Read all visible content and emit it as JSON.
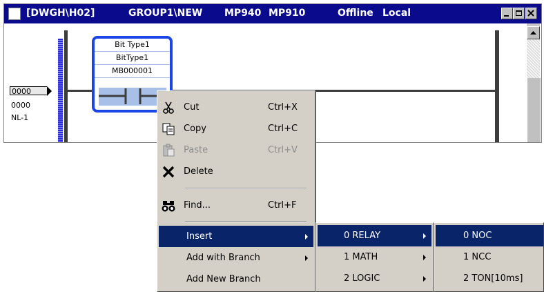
{
  "window": {
    "title": {
      "path": "[DWGH\\H02]",
      "group": "GROUP1\\NEW",
      "model1": "MP940",
      "model2": "MP910",
      "status": "Offline",
      "mode": "Local"
    }
  },
  "ladder": {
    "input_tag": "0000",
    "rung_number": "0000",
    "rung_label": "NL-1",
    "contact": {
      "line1": "Bit Type1",
      "line2": "BitType1",
      "address": "MB000001"
    }
  },
  "context_menu": {
    "items": [
      {
        "label": "Cut",
        "shortcut": "Ctrl+X",
        "mnemonic": "t",
        "icon": "scissors-icon"
      },
      {
        "label": "Copy",
        "shortcut": "Ctrl+C",
        "mnemonic": "C",
        "icon": "copy-icon"
      },
      {
        "label": "Paste",
        "shortcut": "Ctrl+V",
        "mnemonic": "P",
        "icon": "paste-icon",
        "disabled": true
      },
      {
        "label": "Delete",
        "shortcut": "",
        "mnemonic": "D",
        "icon": "delete-x-icon"
      },
      {
        "label": "Find...",
        "shortcut": "Ctrl+F",
        "mnemonic": "F",
        "icon": "binoculars-icon"
      },
      {
        "label": "Insert",
        "submenu": true,
        "highlighted": true
      },
      {
        "label": "Add with Branch",
        "submenu": true
      },
      {
        "label": "Add New Branch",
        "mnemonic": "B"
      }
    ]
  },
  "insert_submenu": {
    "items": [
      {
        "label": "0 RELAY",
        "submenu": true,
        "highlighted": true
      },
      {
        "label": "1 MATH",
        "submenu": true
      },
      {
        "label": "2 LOGIC",
        "submenu": true
      }
    ]
  },
  "relay_submenu": {
    "items": [
      {
        "label": "0 NOC",
        "highlighted": true
      },
      {
        "label": "1 NCC"
      },
      {
        "label": "2 TON[10ms]"
      }
    ]
  },
  "colors": {
    "title_bar": "#0a0a8c",
    "menu_highlight": "#0a246a",
    "contact_border": "#1a46e6"
  }
}
